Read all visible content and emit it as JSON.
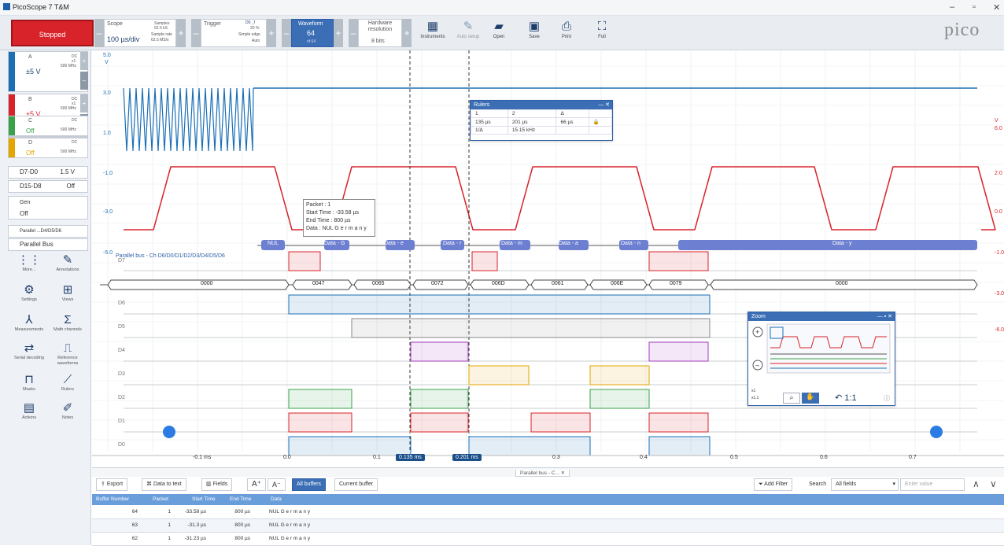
{
  "window": {
    "title": "PicoScope 7 T&M",
    "controls": [
      "–",
      "▫",
      "✕"
    ]
  },
  "toolbar": {
    "stop_label": "Stopped",
    "scope": {
      "label": "Scope",
      "value": "100 µs/div",
      "samples_label": "Samples",
      "samples_value": "62.5 kS",
      "rate_label": "Sample rate",
      "rate_value": "62.5 MS/s"
    },
    "trigger": {
      "label": "Trigger",
      "channel": "D0 _f",
      "percent": "20 %",
      "mode": "Simple edge",
      "auto": "Auto"
    },
    "waveform": {
      "label": "Waveform",
      "value": "64",
      "of": "of 64"
    },
    "hardware": {
      "label": "Hardware resolution",
      "value": "8 bits"
    },
    "icons": [
      {
        "icon": "instruments-icon",
        "label": "Instruments"
      },
      {
        "icon": "autosetup-icon",
        "label": "Auto setup"
      },
      {
        "icon": "open-icon",
        "label": "Open"
      },
      {
        "icon": "save-icon",
        "label": "Save"
      },
      {
        "icon": "print-icon",
        "label": "Print"
      },
      {
        "icon": "full-icon",
        "label": "Full"
      }
    ],
    "logo": "pico"
  },
  "sidebar": {
    "channels": [
      {
        "name": "A",
        "range": "±5 V",
        "coupling": "DC",
        "probe": "x1",
        "bw": "500 MHz",
        "color": "#1b6fb5"
      },
      {
        "name": "B",
        "range": "±5 V",
        "coupling": "DC",
        "probe": "x1",
        "bw": "500 MHz",
        "color": "#d8232a"
      },
      {
        "name": "C",
        "range": "Off",
        "coupling": "DC",
        "probe": "x1",
        "bw": "500 MHz",
        "color": "#3aa14a"
      },
      {
        "name": "D",
        "range": "Off",
        "coupling": "DC",
        "probe": "x1",
        "bw": "500 MHz",
        "color": "#e5a400"
      }
    ],
    "digital": [
      {
        "name": "D7-D0",
        "value": "1.5 V"
      },
      {
        "name": "D15-D8",
        "value": "Off"
      }
    ],
    "gen": {
      "name": "Gen",
      "value": "Off"
    },
    "parallel_small": "Parallel ...D4/D5/D6",
    "parallel_bus": "Parallel Bus",
    "tools": [
      {
        "icon": "more-icon",
        "label": "More..."
      },
      {
        "icon": "annotations-icon",
        "label": "Annotations"
      },
      {
        "icon": "settings-icon",
        "label": "Settings"
      },
      {
        "icon": "views-icon",
        "label": "Views"
      },
      {
        "icon": "measurements-icon",
        "label": "Measurements"
      },
      {
        "icon": "math-channels-icon",
        "label": "Math channels"
      },
      {
        "icon": "serial-decoding-icon",
        "label": "Serial decoding"
      },
      {
        "icon": "reference-waveforms-icon",
        "label": "Reference waveforms"
      },
      {
        "icon": "masks-icon",
        "label": "Masks"
      },
      {
        "icon": "rulers-icon",
        "label": "Rulers"
      },
      {
        "icon": "actions-icon",
        "label": "Actions"
      },
      {
        "icon": "notes-icon",
        "label": "Notes"
      }
    ]
  },
  "scope": {
    "left_axis": {
      "unit": "V",
      "top": "5.0",
      "ticks": [
        "3.0",
        "1.0",
        "-1.0",
        "-3.0",
        "-5.0"
      ]
    },
    "right_axis": {
      "unit": "V",
      "top": "6.0",
      "ticks": [
        "2.0",
        "0.0",
        "-1.0",
        "-3.0",
        "-6.0"
      ]
    },
    "time_ticks": [
      "-0.1 ms",
      "0.0",
      "0.1",
      "0.3",
      "0.4",
      "0.5",
      "0.6",
      "0.7"
    ],
    "ruler_tags": [
      "0.135 ms",
      "0.201 ms"
    ],
    "bus_label": "Parallel bus - Ch D6/D0/D1/D2/D3/D4/D5/D6",
    "bus_segments": [
      "NUL",
      "Data - G",
      "Data - e",
      "Data - r",
      "Data - m",
      "Data - a",
      "Data - n",
      "Data - y"
    ],
    "hex_values": [
      "0000",
      "0047",
      "0065",
      "0072",
      "006D",
      "0061",
      "006E",
      "0079",
      "0000"
    ],
    "digital_labels": [
      "D7",
      "D6",
      "D5",
      "D4",
      "D3",
      "D2",
      "D1",
      "D0"
    ],
    "tooltip": {
      "packet": "Packet : 1",
      "start": "Start Time : -33.58 µs",
      "end": "End Time : 800 µs",
      "data": "Data : NUL G e r m a n y"
    },
    "rulers": {
      "title": "Rulers",
      "h1": "1",
      "h2": "2",
      "h3": "Δ",
      "v1": "135 µs",
      "v2": "201 µs",
      "v3": "66 µs",
      "inv": "1/Δ",
      "freq": "15.15 kHz"
    },
    "zoom": {
      "title": "Zoom",
      "scale1": "x1",
      "scale2": "x1.1",
      "ratio": "1:1"
    }
  },
  "decode_tab": "Parallel bus - C...",
  "decode_toolbar": {
    "export": "Export",
    "to_text": "Data to text",
    "fields": "Fields",
    "all_buffers": "All buffers",
    "current_buffer": "Current buffer",
    "add_filter": "Add Filter",
    "search_label": "Search",
    "search_value": "All fields",
    "enter_value": "Enter value"
  },
  "decode_table": {
    "columns": [
      "Buffer Number",
      "Packet",
      "Start Time",
      "End Time",
      "Data"
    ],
    "rows": [
      [
        "64",
        "1",
        "-33.58 µs",
        "800 µs",
        "NUL G e r m a n y"
      ],
      [
        "63",
        "1",
        "-31.3 µs",
        "800 µs",
        "NUL G e r m a n y"
      ],
      [
        "62",
        "1",
        "-31.23 µs",
        "800 µs",
        "NUL G e r m a n y"
      ]
    ]
  }
}
